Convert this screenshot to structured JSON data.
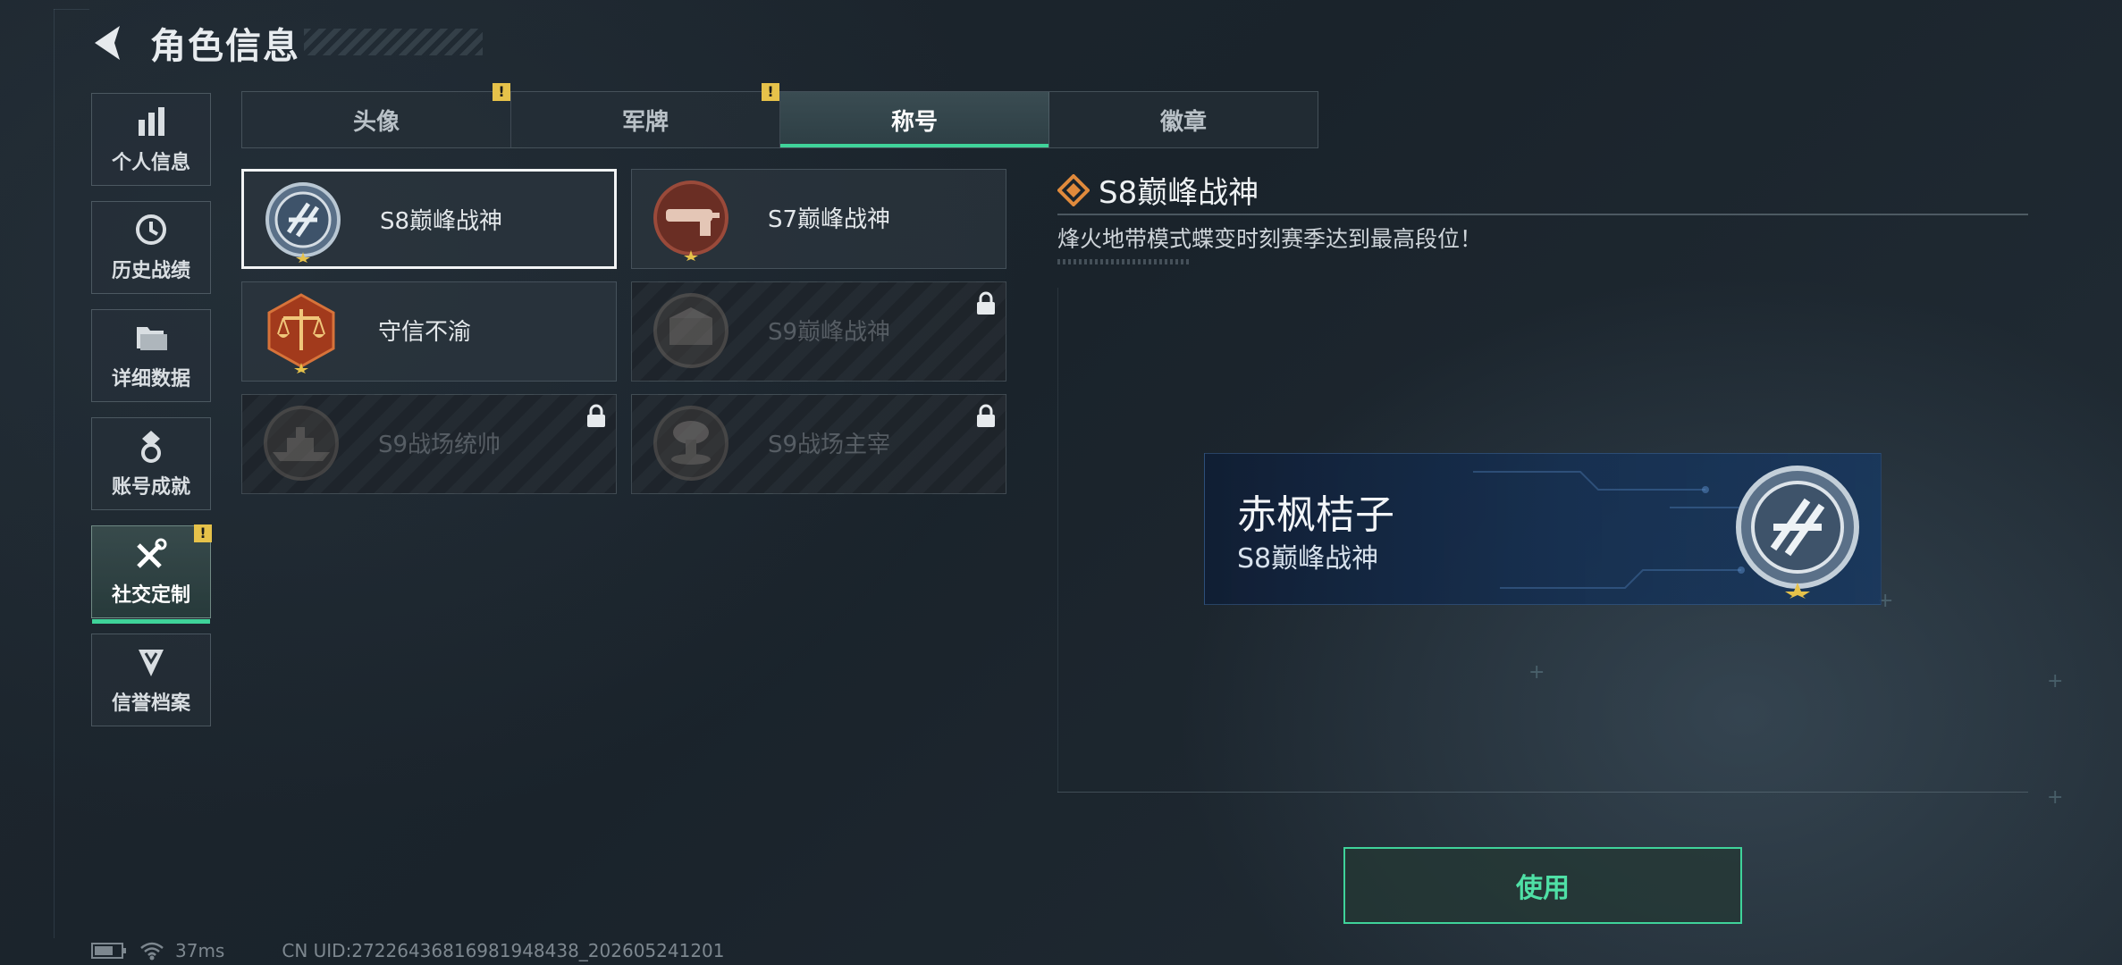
{
  "header": {
    "title": "角色信息"
  },
  "sidebar": {
    "items": [
      {
        "label": "个人信息",
        "icon": "bar-chart-icon",
        "active": false
      },
      {
        "label": "历史战绩",
        "icon": "history-clock-icon",
        "active": false
      },
      {
        "label": "详细数据",
        "icon": "folder-icon",
        "active": false
      },
      {
        "label": "账号成就",
        "icon": "medal-icon",
        "active": false
      },
      {
        "label": "社交定制",
        "icon": "wrench-screwdriver-icon",
        "active": true,
        "badge": "!"
      },
      {
        "label": "信誉档案",
        "icon": "shield-chevron-icon",
        "active": false
      }
    ]
  },
  "tabs": [
    {
      "label": "头像",
      "badge": "!",
      "active": false
    },
    {
      "label": "军牌",
      "badge": "!",
      "active": false
    },
    {
      "label": "称号",
      "active": true
    },
    {
      "label": "徽章",
      "active": false
    }
  ],
  "titles": [
    {
      "name": "S8巅峰战神",
      "emblem": "s8-peak-emblem",
      "locked": false,
      "selected": true
    },
    {
      "name": "S7巅峰战神",
      "emblem": "s7-peak-emblem",
      "locked": false,
      "selected": false
    },
    {
      "name": "守信不渝",
      "emblem": "scales-emblem",
      "locked": false,
      "selected": false
    },
    {
      "name": "S9巅峰战神",
      "emblem": "s9-peak-emblem",
      "locked": true,
      "selected": false
    },
    {
      "name": "S9战场统帅",
      "emblem": "battleship-emblem",
      "locked": true,
      "selected": false
    },
    {
      "name": "S9战场主宰",
      "emblem": "mushroom-cloud-emblem",
      "locked": true,
      "selected": false
    }
  ],
  "detail": {
    "title": "S8巅峰战神",
    "description": "烽火地带模式蝶变时刻赛季达到最高段位！",
    "preview": {
      "player_name": "赤枫桔子",
      "title": "S8巅峰战神"
    },
    "use_button": "使用"
  },
  "status": {
    "ping": "37ms",
    "uid": "CN UID:27226436816981948438_202605241201"
  },
  "colors": {
    "accent": "#3fd39a",
    "warning": "#e6c24a",
    "diamond": "#e08a3c"
  }
}
